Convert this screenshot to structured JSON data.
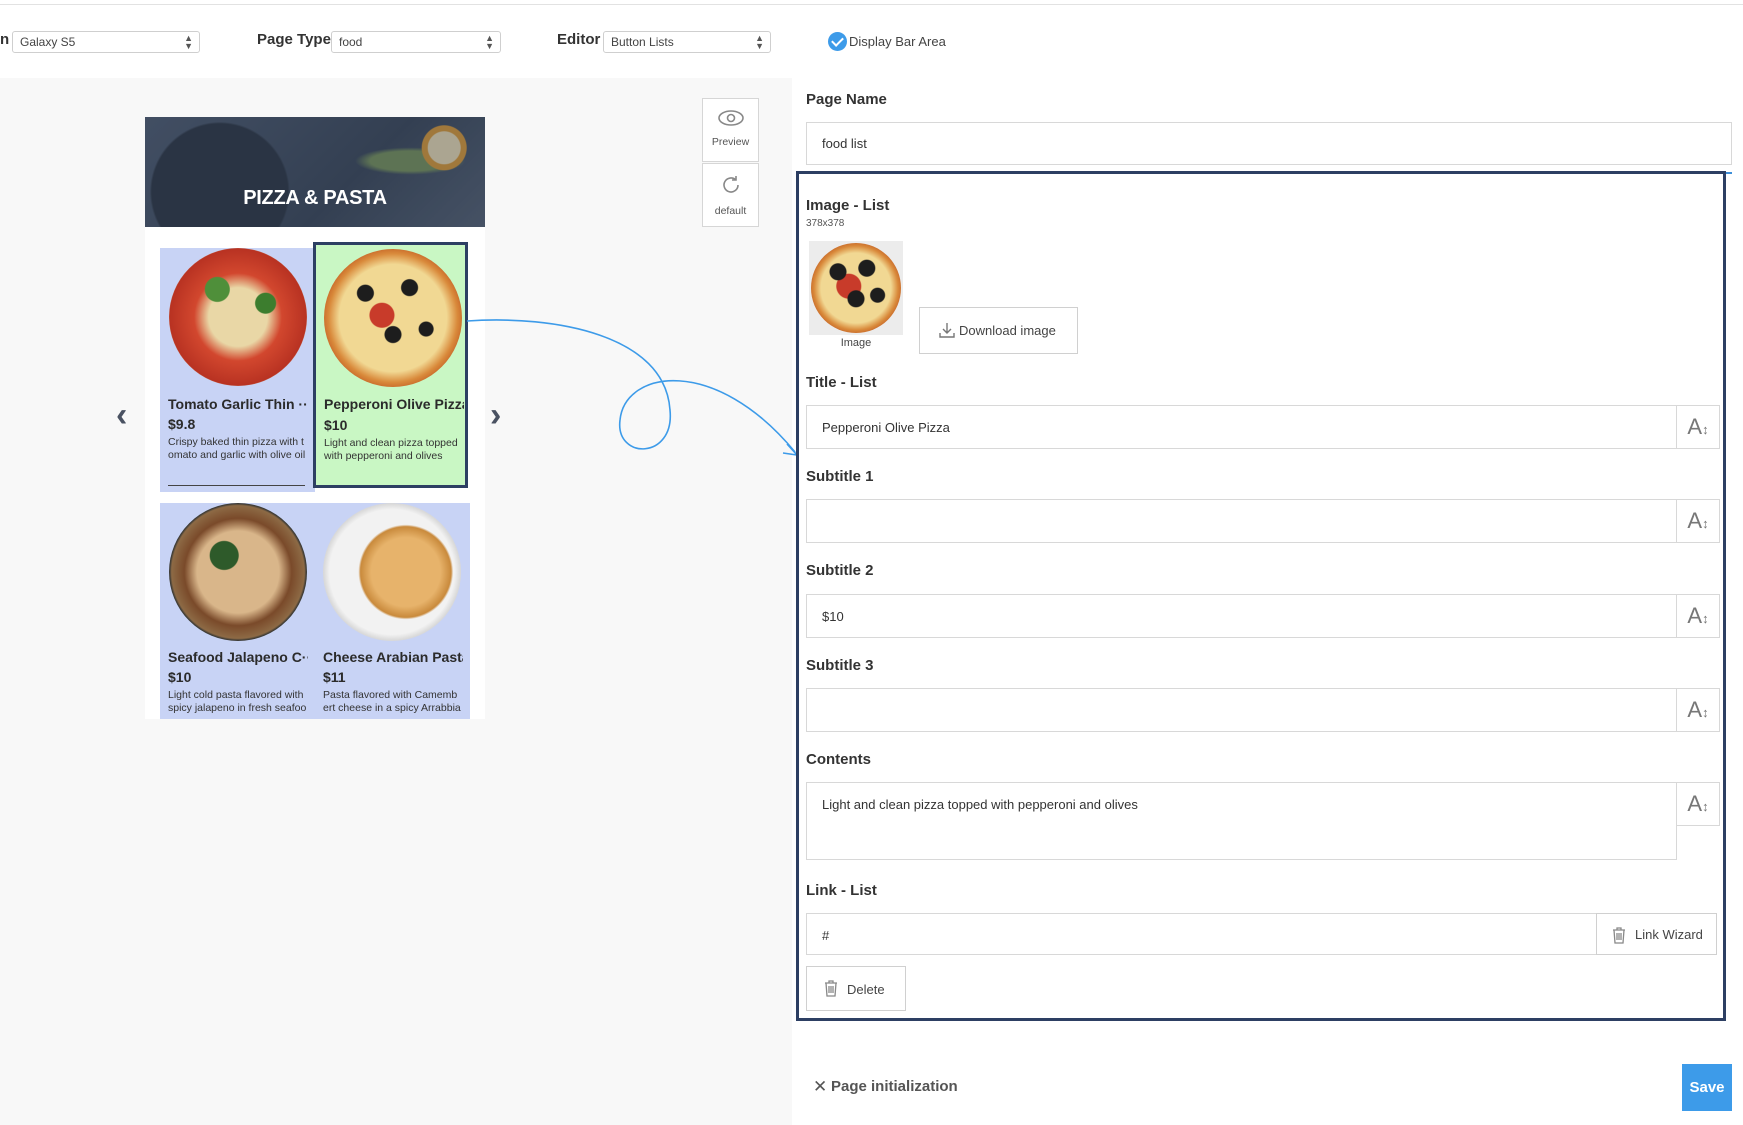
{
  "toolbar": {
    "device_label": "n",
    "device_value": "Galaxy S5",
    "page_type_label": "Page Type",
    "page_type_value": "food",
    "editor_label": "Editor",
    "editor_value": "Button Lists",
    "display_bar_label": "Display Bar Area",
    "display_bar_checked": true
  },
  "preview": {
    "banner_title": "PIZZA & PASTA",
    "items": [
      {
        "title": "Tomato Garlic Thin ···",
        "price": "$9.8",
        "desc": "Crispy baked thin pizza with tomato and garlic with olive oil"
      },
      {
        "title": "Pepperoni Olive Pizza",
        "price": "$10",
        "desc": "Light and clean pizza topped with pepperoni and olives"
      },
      {
        "title": "Seafood Jalapeno C···",
        "price": "$10",
        "desc": "Light cold pasta flavored with spicy jalapeno in fresh seafoo"
      },
      {
        "title": "Cheese Arabian Pasta",
        "price": "$11",
        "desc": "Pasta flavored with Camembert cheese in a spicy Arrabbiata"
      }
    ],
    "prev_arrow": "‹",
    "next_arrow": "›"
  },
  "tools": {
    "preview_label": "Preview",
    "default_label": "default",
    "preview_icon": "eye-icon",
    "default_icon": "refresh-icon"
  },
  "editor": {
    "page_name_label": "Page Name",
    "page_name_value": "food list",
    "image_list_label": "Image - List",
    "image_size": "378x378",
    "image_caption": "Image",
    "download_button": "Download image",
    "title_list_label": "Title - List",
    "title_list_value": "Pepperoni Olive Pizza",
    "subtitle1_label": "Subtitle 1",
    "subtitle1_value": "",
    "subtitle2_label": "Subtitle 2",
    "subtitle2_value": "$10",
    "subtitle3_label": "Subtitle 3",
    "subtitle3_value": "",
    "contents_label": "Contents",
    "contents_value": "Light and clean pizza topped with pepperoni and olives",
    "link_list_label": "Link - List",
    "link_list_value": "#",
    "link_wizard_button": "Link Wizard",
    "delete_button": "Delete"
  },
  "footer": {
    "page_init_label": "Page initialization",
    "save_button": "Save"
  },
  "colors": {
    "accent": "#3d9be9",
    "selected_card": "#c9f7c4",
    "card": "#c8d3f5",
    "highlight_border": "#2d3f63"
  }
}
